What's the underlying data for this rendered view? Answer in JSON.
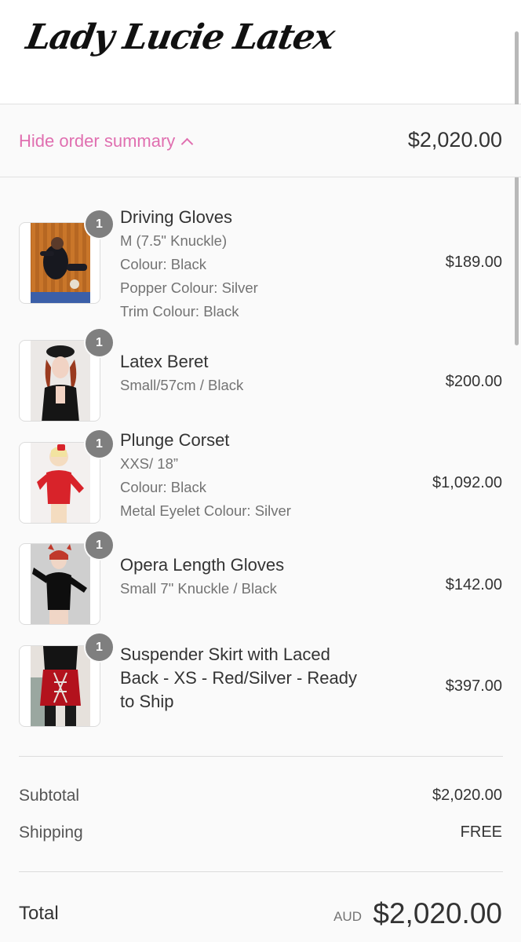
{
  "brand": {
    "logo_text": "Lady Lucie Latex"
  },
  "summary_toggle": {
    "label": "Hide order summary",
    "total": "$2,020.00"
  },
  "items": [
    {
      "qty": "1",
      "name": "Driving Gloves",
      "variants": [
        "M (7.5\" Knuckle)",
        "Colour: Black",
        "Popper Colour: Silver",
        "Trim Colour: Black"
      ],
      "price": "$189.00"
    },
    {
      "qty": "1",
      "name": "Latex Beret",
      "variants": [
        "Small/57cm / Black"
      ],
      "price": "$200.00"
    },
    {
      "qty": "1",
      "name": "Plunge Corset",
      "variants": [
        "XXS/ 18”",
        "Colour: Black",
        "Metal Eyelet Colour: Silver"
      ],
      "price": "$1,092.00"
    },
    {
      "qty": "1",
      "name": "Opera Length Gloves",
      "variants": [
        "Small 7\" Knuckle / Black"
      ],
      "price": "$142.00"
    },
    {
      "qty": "1",
      "name_lines": [
        "Suspender Skirt with Laced",
        "Back - XS - Red/Silver - Ready",
        "to Ship"
      ],
      "price": "$397.00"
    }
  ],
  "subtotal": {
    "label": "Subtotal",
    "value": "$2,020.00"
  },
  "shipping": {
    "label": "Shipping",
    "value": "FREE"
  },
  "total": {
    "label": "Total",
    "currency": "AUD",
    "amount": "$2,020.00"
  },
  "colors": {
    "accent": "#e06fb0",
    "badge": "#7f7f7f",
    "text": "#333333",
    "muted": "#737373"
  }
}
